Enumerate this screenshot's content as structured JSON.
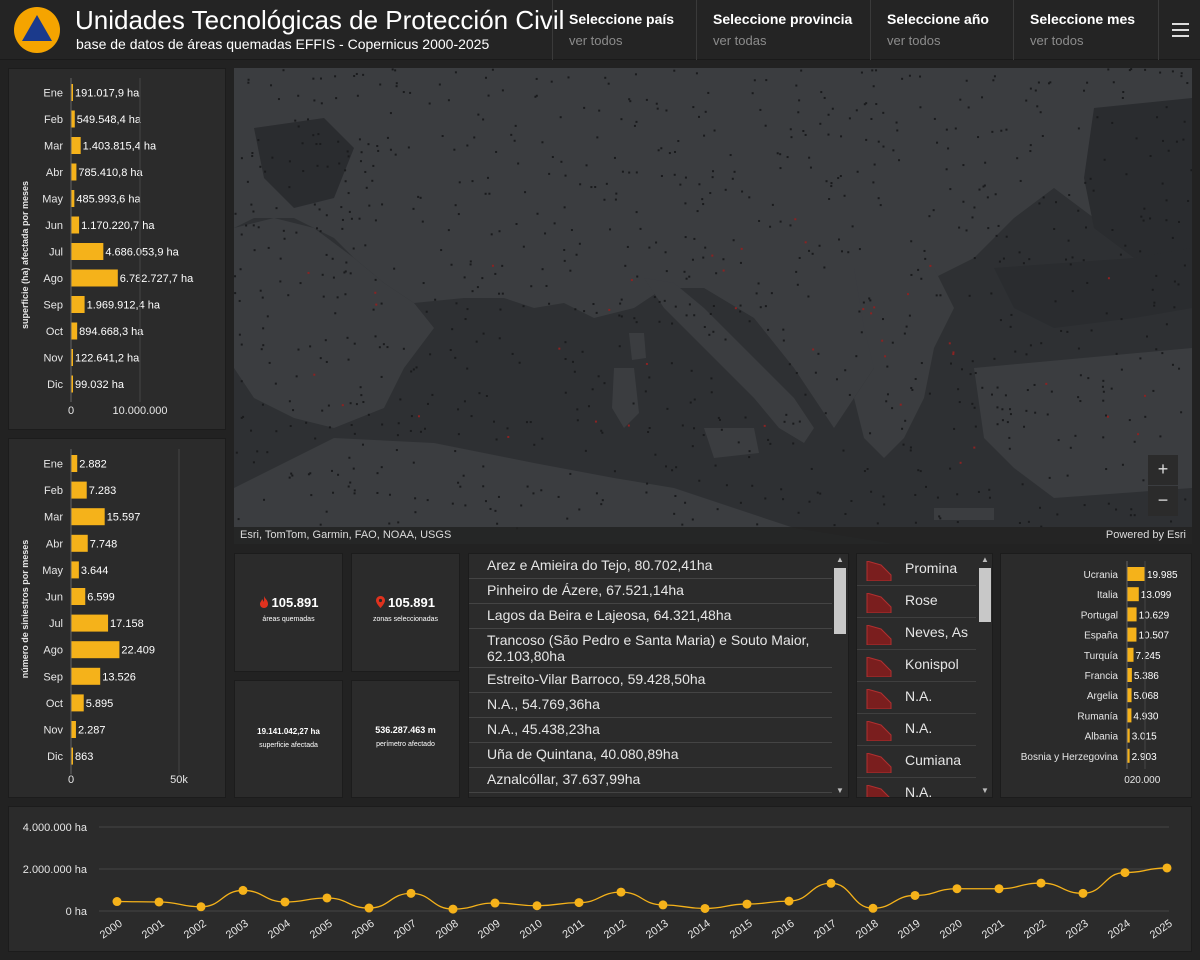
{
  "header": {
    "title": "Unidades Tecnológicas de Protección Civil",
    "subtitle": "base de datos de áreas quemadas EFFIS - Copernicus 2000-2025",
    "selectors": [
      {
        "label": "Seleccione país",
        "value": "ver todos"
      },
      {
        "label": "Seleccione provincia",
        "value": "ver todas"
      },
      {
        "label": "Seleccione año",
        "value": "ver todos"
      },
      {
        "label": "Seleccione mes",
        "value": "ver todos"
      }
    ],
    "menu_icon": "hamburger-menu-icon"
  },
  "map": {
    "attribution": "Esri, TomTom, Garmin, FAO, NOAA, USGS",
    "powered_by": "Powered by Esri",
    "zoom_in": "+",
    "zoom_out": "−"
  },
  "kpis": {
    "burned_areas": {
      "value": "105.891",
      "caption": "áreas quemadas",
      "icon": "fire-icon"
    },
    "selected_zones": {
      "value": "105.891",
      "caption": "zonas seleccionadas",
      "icon": "map-pin-icon"
    },
    "surface": {
      "value": "19.141.042,27 ha",
      "caption": "superficie afectada"
    },
    "perimeter": {
      "value": "536.287.463 m",
      "caption": "perímetro afectado"
    }
  },
  "fires_list": [
    "Arez e Amieira do Tejo, 80.702,41ha",
    "Pinheiro de Ázere, 67.521,14ha",
    "Lagos da Beira e Lajeosa, 64.321,48ha",
    "Trancoso (São Pedro e Santa Maria) e Souto Maior, 62.103,80ha",
    "Estreito-Vilar Barroco, 59.428,50ha",
    "N.A., 54.769,36ha",
    "N.A., 45.438,23ha",
    "Uña de Quintana, 40.080,89ha",
    "Aznalcóllar, 37.637,99ha"
  ],
  "provinces_list": [
    "Promina",
    "Rose",
    "Neves, As",
    "Konispol",
    "N.A.",
    "N.A.",
    "Cumiana",
    "N.A."
  ],
  "chart_data": [
    {
      "type": "bar",
      "orientation": "horizontal",
      "ylabel": "superficie (ha) afectada por meses",
      "categories": [
        "Ene",
        "Feb",
        "Mar",
        "Abr",
        "May",
        "Jun",
        "Jul",
        "Ago",
        "Sep",
        "Oct",
        "Nov",
        "Dic"
      ],
      "values": [
        191017.9,
        549548.4,
        1403815.4,
        785410.8,
        485993.6,
        1170220.7,
        4686053.9,
        6782727.7,
        1969912.4,
        894668.3,
        122641.2,
        99032
      ],
      "value_labels": [
        "191.017,9 ha",
        "549.548,4 ha",
        "1.403.815,4 ha",
        "785.410,8 ha",
        "485.993,6 ha",
        "1.170.220,7 ha",
        "4.686.053,9 ha",
        "6.782.727,7 ha",
        "1.969.912,4 ha",
        "894.668,3 ha",
        "122.641,2 ha",
        "99.032 ha"
      ],
      "xlim": [
        0,
        10000000
      ],
      "ticks": [
        "0",
        "10.000.000"
      ],
      "bar_color": "#f5b21a"
    },
    {
      "type": "bar",
      "orientation": "horizontal",
      "ylabel": "número de siniestros por meses",
      "categories": [
        "Ene",
        "Feb",
        "Mar",
        "Abr",
        "May",
        "Jun",
        "Jul",
        "Ago",
        "Sep",
        "Oct",
        "Nov",
        "Dic"
      ],
      "values": [
        2882,
        7283,
        15597,
        7748,
        3644,
        6599,
        17158,
        22409,
        13526,
        5895,
        2287,
        863
      ],
      "value_labels": [
        "2.882",
        "7.283",
        "15.597",
        "7.748",
        "3.644",
        "6.599",
        "17.158",
        "22.409",
        "13.526",
        "5.895",
        "2.287",
        "863"
      ],
      "xlim": [
        0,
        50000
      ],
      "ticks": [
        "0",
        "50k"
      ],
      "bar_color": "#f5b21a"
    },
    {
      "type": "bar",
      "orientation": "horizontal",
      "categories": [
        "Ucrania",
        "Italia",
        "Portugal",
        "España",
        "Turquía",
        "Francia",
        "Argelia",
        "Rumanía",
        "Albania",
        "Bosnia y Herzegovina"
      ],
      "values": [
        19985,
        13099,
        10629,
        10507,
        7245,
        5386,
        5068,
        4930,
        3015,
        2903
      ],
      "value_labels": [
        "19.985",
        "13.099",
        "10.629",
        "10.507",
        "7.245",
        "5.386",
        "5.068",
        "4.930",
        "3.015",
        "2.903"
      ],
      "xlim": [
        0,
        20000
      ],
      "ticks": [
        "0",
        "20.000"
      ],
      "bar_color": "#f5b21a"
    },
    {
      "type": "line",
      "x": [
        "2000",
        "2001",
        "2002",
        "2003",
        "2004",
        "2005",
        "2006",
        "2007",
        "2008",
        "2009",
        "2010",
        "2011",
        "2012",
        "2013",
        "2014",
        "2015",
        "2016",
        "2017",
        "2018",
        "2019",
        "2020",
        "2021",
        "2022",
        "2023",
        "2024",
        "2025"
      ],
      "values": [
        450000,
        430000,
        200000,
        980000,
        430000,
        620000,
        140000,
        840000,
        90000,
        380000,
        250000,
        400000,
        900000,
        290000,
        120000,
        330000,
        470000,
        1320000,
        130000,
        740000,
        1060000,
        1060000,
        1330000,
        840000,
        1830000,
        2050000
      ],
      "ylim": [
        0,
        4000000
      ],
      "ticks": [
        "0 ha",
        "2.000.000 ha",
        "4.000.000 ha"
      ],
      "line_color": "#f5b21a"
    }
  ]
}
